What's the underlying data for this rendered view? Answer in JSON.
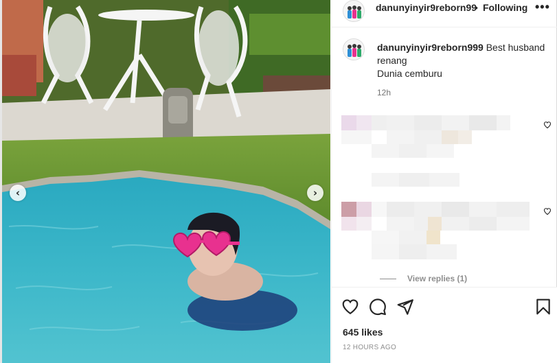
{
  "post": {
    "username": "danunyinyir9reborn99",
    "separator": "•",
    "follow_status": "Following",
    "more_label": "•••"
  },
  "caption": {
    "username": "danunyinyir9reborn999",
    "text_line1": "Best husband",
    "text_line2": "renang",
    "text_line3": "Dunia cemburu",
    "time": "12h"
  },
  "comments": {
    "view_replies": "View replies (1)"
  },
  "carousel": {
    "prev_glyph": "‹",
    "next_glyph": "›"
  },
  "engagement": {
    "likes": "645 likes",
    "posted_ago": "12 HOURS AGO"
  },
  "colors": {
    "pool": "#3fb3c4",
    "lawn": "#6f9a35",
    "goggles": "#e8318f"
  }
}
